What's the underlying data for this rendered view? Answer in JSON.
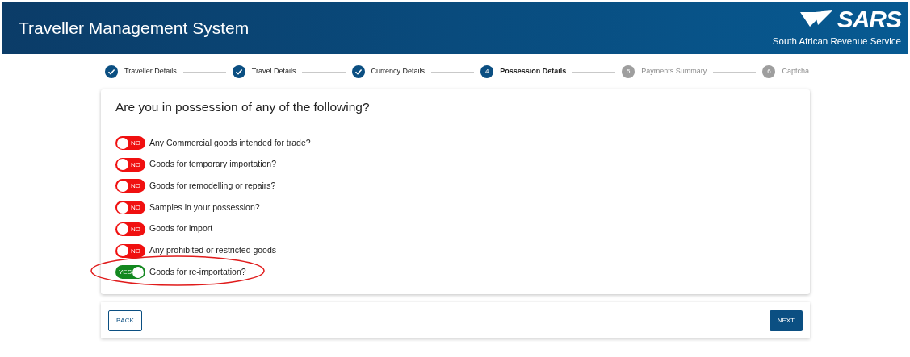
{
  "header": {
    "title": "Traveller Management System",
    "logo_text": "SARS",
    "subtitle": "South African Revenue Service"
  },
  "steps": [
    {
      "label": "Traveller Details",
      "completed": true,
      "selected": false
    },
    {
      "label": "Travel Details",
      "completed": true,
      "selected": false
    },
    {
      "label": "Currency Details",
      "completed": true,
      "selected": false
    },
    {
      "number": "4",
      "label": "Possession Details",
      "completed": false,
      "selected": true
    },
    {
      "number": "5",
      "label": "Payments Summary",
      "completed": false,
      "selected": false
    },
    {
      "number": "6",
      "label": "Captcha",
      "completed": false,
      "selected": false
    }
  ],
  "question": "Are you in possession of any of the following?",
  "items": [
    {
      "label": "Any Commercial goods intended for trade?",
      "on": false,
      "toggle_text": "NO",
      "highlighted": false
    },
    {
      "label": "Goods for temporary importation?",
      "on": false,
      "toggle_text": "NO",
      "highlighted": false
    },
    {
      "label": "Goods for remodelling or repairs?",
      "on": false,
      "toggle_text": "NO",
      "highlighted": false
    },
    {
      "label": "Samples in your possession?",
      "on": false,
      "toggle_text": "NO",
      "highlighted": false
    },
    {
      "label": "Goods for import",
      "on": false,
      "toggle_text": "NO",
      "highlighted": false
    },
    {
      "label": "Any prohibited or restricted goods",
      "on": false,
      "toggle_text": "NO",
      "highlighted": false
    },
    {
      "label": "Goods for re-importation?",
      "on": true,
      "toggle_text": "YES",
      "highlighted": true
    }
  ],
  "buttons": {
    "back": "BACK",
    "next": "NEXT"
  }
}
